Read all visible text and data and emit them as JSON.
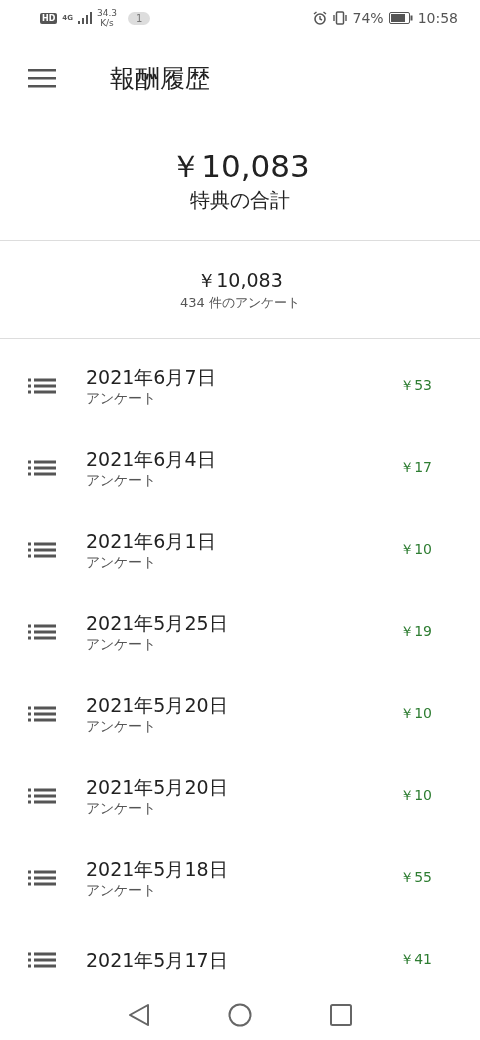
{
  "status_bar": {
    "hd": "HD",
    "network": "4G",
    "speed": "34.3",
    "speed_unit": "K/s",
    "notification_count": "1",
    "battery": "74%",
    "time": "10:58"
  },
  "app_bar": {
    "title": "報酬履歴"
  },
  "total": {
    "amount": "￥10,083",
    "label": "特典の合計"
  },
  "summary": {
    "amount": "￥10,083",
    "count": "434 件のアンケート"
  },
  "rewards": [
    {
      "date": "2021年6月7日",
      "type": "アンケート",
      "amount": "￥53"
    },
    {
      "date": "2021年6月4日",
      "type": "アンケート",
      "amount": "￥17"
    },
    {
      "date": "2021年6月1日",
      "type": "アンケート",
      "amount": "￥10"
    },
    {
      "date": "2021年5月25日",
      "type": "アンケート",
      "amount": "￥19"
    },
    {
      "date": "2021年5月20日",
      "type": "アンケート",
      "amount": "￥10"
    },
    {
      "date": "2021年5月20日",
      "type": "アンケート",
      "amount": "￥10"
    },
    {
      "date": "2021年5月18日",
      "type": "アンケート",
      "amount": "￥55"
    },
    {
      "date": "2021年5月17日",
      "amount": "￥41"
    }
  ]
}
